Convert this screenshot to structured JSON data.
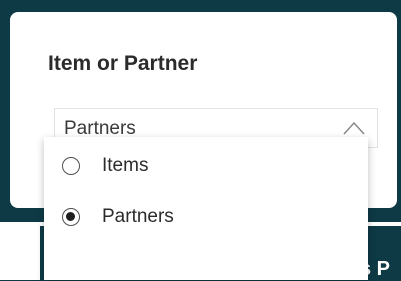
{
  "slicer": {
    "title": "Item or Partner",
    "selected_value": "Partners",
    "options": [
      {
        "label": "Items",
        "selected": false
      },
      {
        "label": "Partners",
        "selected": true
      }
    ]
  },
  "background": {
    "partial_text": "s P"
  },
  "colors": {
    "background": "#0e3a46",
    "card": "#ffffff"
  },
  "icons": {
    "dropdown_toggle": "chevron-up-icon"
  }
}
